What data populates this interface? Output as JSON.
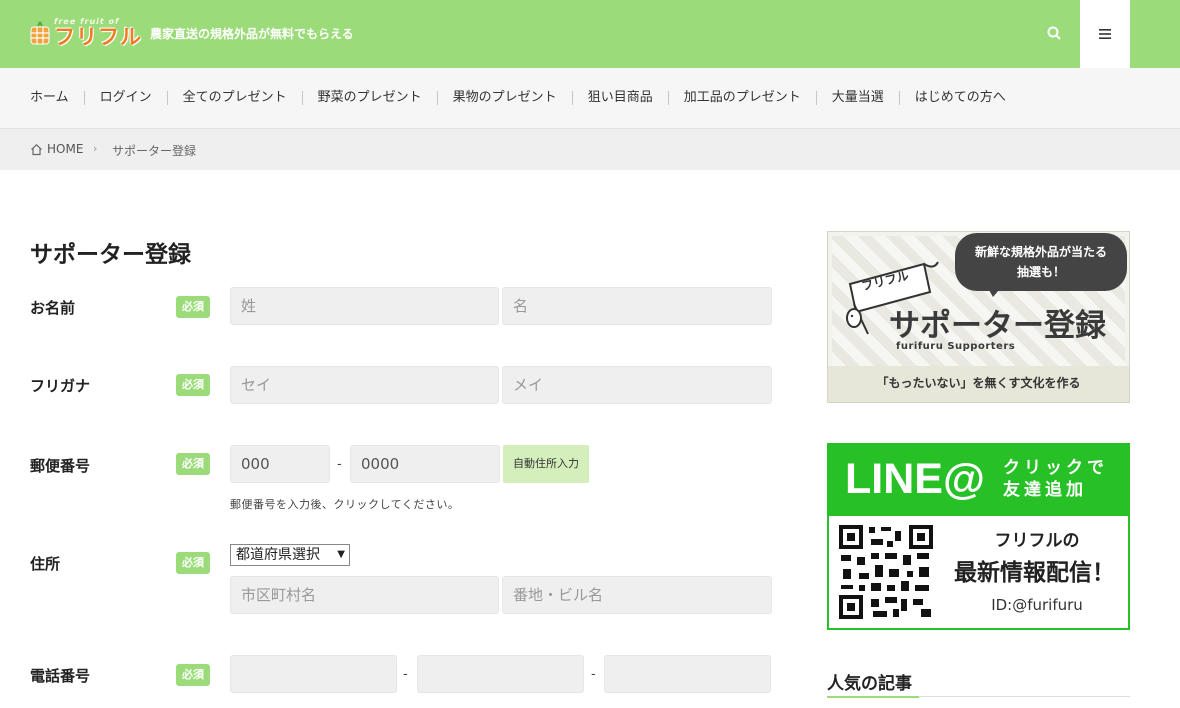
{
  "header": {
    "logo_small": "free fruit of",
    "logo_text": "フリフル",
    "tagline": "農家直送の規格外品が無料でもらえる"
  },
  "nav": {
    "items": [
      "ホーム",
      "ログイン",
      "全てのプレゼント",
      "野菜のプレゼント",
      "果物のプレゼント",
      "狙い目商品",
      "加工品のプレゼント",
      "大量当選",
      "はじめての方へ"
    ]
  },
  "breadcrumb": {
    "home": "HOME",
    "separator": "›",
    "current": "サポーター登録"
  },
  "form": {
    "title": "サポーター登録",
    "required_badge": "必須",
    "name": {
      "label": "お名前",
      "last_placeholder": "姓",
      "first_placeholder": "名"
    },
    "kana": {
      "label": "フリガナ",
      "last_placeholder": "セイ",
      "first_placeholder": "メイ"
    },
    "postal": {
      "label": "郵便番号",
      "first_placeholder": "000",
      "second_placeholder": "0000",
      "dash": "-",
      "auto_button": "自動住所入力",
      "hint": "郵便番号を入力後、クリックしてください。"
    },
    "address": {
      "label": "住所",
      "prefecture_selected": "都道府県選択",
      "select_arrow": "▼",
      "city_placeholder": "市区町村名",
      "street_placeholder": "番地・ビル名"
    },
    "phone": {
      "label": "電話番号",
      "dash": "-"
    }
  },
  "sidebar": {
    "supporter_banner": {
      "bubble_line1": "新鮮な規格外品が当たる",
      "bubble_line2": "抽選も！",
      "flag_text": "フリフル",
      "title": "サポーター登録",
      "subtitle": "furifuru Supporters",
      "caption": "「もったいない」を無くす文化を作る"
    },
    "line_banner": {
      "logo": "LINE@",
      "click_line1": "クリックで",
      "click_line2": "友達追加",
      "title": "フリフルの",
      "main": "最新情報配信！",
      "id": "ID:@furifuru"
    },
    "popular_heading": "人気の記事"
  },
  "colors": {
    "brand_green": "#9bdb79",
    "line_green": "#27c027",
    "logo_orange": "#f07c1f"
  }
}
